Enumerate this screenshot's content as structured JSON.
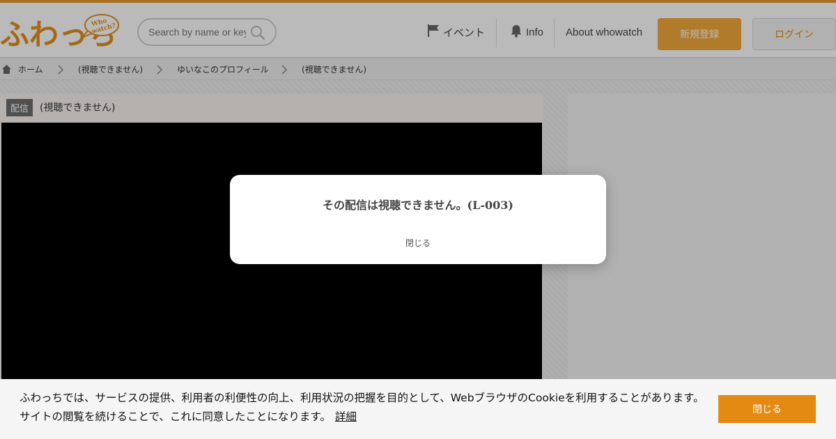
{
  "header": {
    "logo": {
      "text": "ふわっち",
      "bubble_line1": "Who",
      "bubble_line2": "watch?"
    },
    "search": {
      "placeholder": "Search by name or keyword"
    },
    "nav": {
      "event_label": "イベント",
      "info_label": "Info",
      "about_label": "About whowatch",
      "register_label": "新規登録",
      "login_label": "ログイン"
    }
  },
  "breadcrumb": {
    "items": [
      "ホーム",
      "(視聴できません)",
      "ゆいなこのプロフィール",
      "(視聴できません)"
    ]
  },
  "panel": {
    "badge": "配信",
    "title": "(視聴できません)"
  },
  "modal": {
    "message": "その配信は視聴できません。(L-003)",
    "close_label": "閉じる"
  },
  "cookie": {
    "text": "ふわっちでは、サービスの提供、利用者の利便性の向上、利用状況の把握を目的として、Webブラウザのを利用することがあります。サイトの閲覧を続けることで、これに同意したことになります。",
    "text_full": "ふわっちでは、サービスの提供、利用者の利便性の向上、利用状況の把握を目的として、WebブラウザのCookieを利用することがあります。サイトの閲覧を続けることで、これに同意したことになります。",
    "link_label": "詳細",
    "button_label": "閉じる"
  },
  "colors": {
    "accent": "#e89b2e",
    "register_bg": "#f3a93d",
    "cookie_button": "#e48a12"
  },
  "icons": {
    "search": "search-icon",
    "flag": "flag-icon",
    "bell": "bell-icon",
    "home": "home-icon",
    "chevron": "chevron-right-icon"
  }
}
